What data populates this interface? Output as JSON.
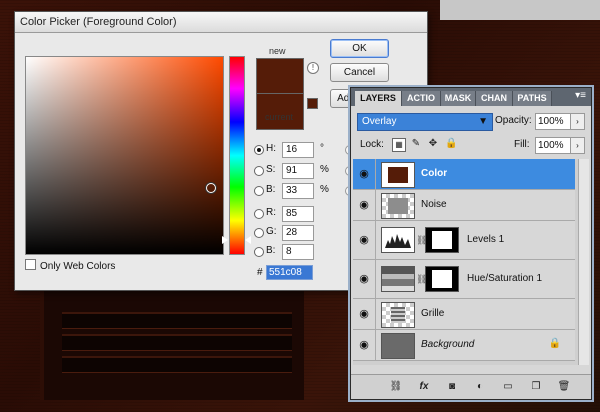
{
  "color_picker": {
    "title": "Color Picker (Foreground Color)",
    "new_label": "new",
    "current_label": "current",
    "buttons": {
      "ok": "OK",
      "cancel": "Cancel",
      "add": "Add"
    },
    "fields": [
      {
        "id": "H",
        "label": "H:",
        "value": "16",
        "unit": "°",
        "selected": true
      },
      {
        "id": "S",
        "label": "S:",
        "value": "91",
        "unit": "%",
        "selected": false
      },
      {
        "id": "B",
        "label": "B:",
        "value": "33",
        "unit": "%",
        "selected": false
      },
      {
        "id": "R",
        "label": "R:",
        "value": "85",
        "unit": "",
        "selected": false
      },
      {
        "id": "G",
        "label": "G:",
        "value": "28",
        "unit": "",
        "selected": false
      },
      {
        "id": "Bl",
        "label": "B:",
        "value": "8",
        "unit": "",
        "selected": false
      }
    ],
    "hex_label": "#",
    "hex_value": "551c08",
    "only_web_colors": "Only Web Colors",
    "colors": {
      "selected": "#551c08",
      "hue_base": "#ff4a00"
    }
  },
  "layers_panel": {
    "tabs": [
      "LAYERS",
      "ACTIO",
      "MASK",
      "CHAN",
      "PATHS"
    ],
    "active_tab": "LAYERS",
    "blend_mode": "Overlay",
    "opacity_label": "Opacity:",
    "opacity_value": "100%",
    "lock_label": "Lock:",
    "fill_label": "Fill:",
    "fill_value": "100%",
    "layers": [
      {
        "name": "Color",
        "selected": true,
        "thumb": "color"
      },
      {
        "name": "Noise",
        "selected": false,
        "thumb": "noise"
      },
      {
        "name": "Levels 1",
        "selected": false,
        "thumb": "levels"
      },
      {
        "name": "Hue/Saturation 1",
        "selected": false,
        "thumb": "huesat"
      },
      {
        "name": "Grille",
        "selected": false,
        "thumb": "grille"
      },
      {
        "name": "Background",
        "selected": false,
        "thumb": "background"
      }
    ],
    "footer_icons": [
      "link-layers-icon",
      "fx-icon",
      "add-mask-icon",
      "adjustment-layer-icon",
      "new-group-icon",
      "new-layer-icon",
      "delete-layer-icon"
    ],
    "colors": {
      "selection": "#3d8be0"
    }
  }
}
